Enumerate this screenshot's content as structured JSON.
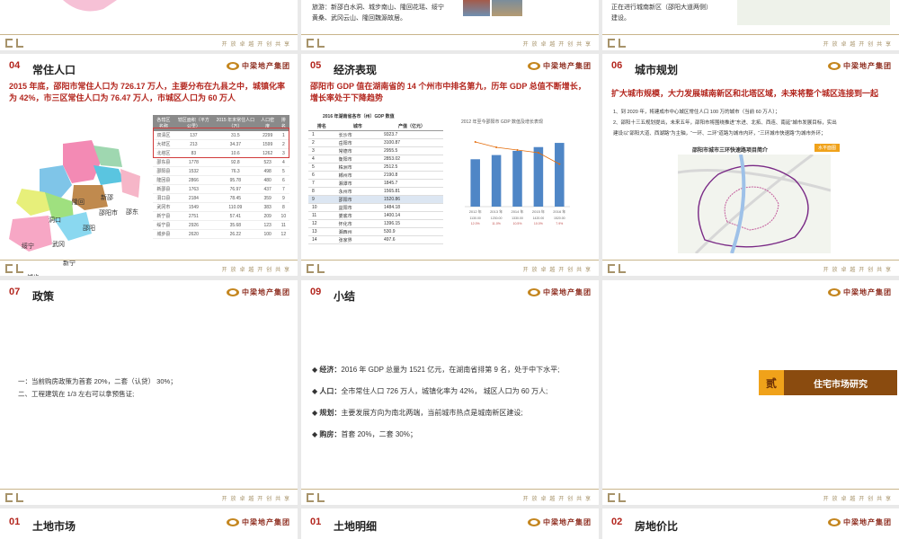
{
  "footer_tagline": "开 放   卓 越   开 创   共 享",
  "brand": "中梁地产集团",
  "top_row": {
    "s2_text_line1": "旅游：新邵白水洞、城步南山、隆回花瑶、绥宁",
    "s2_text_line2": "黄桑、武冈云山、隆回魏源故居。",
    "s3_text_line1": "正在进行城南新区（邵阳大道两侧）",
    "s3_text_line2": "建设。"
  },
  "slides": {
    "population": {
      "num": "04",
      "title": "常住人口",
      "headline": "2015 年底，邵阳市常住人口为 726.17 万人，主要分布在九县之中，城镇化率为 42%，市三区常住人口为 76.47 万人，市城区人口为 60 万人",
      "map_labels": [
        "隆回",
        "新邵",
        "邵阳市",
        "邵东",
        "洞口",
        "邵阳",
        "绥宁",
        "武冈",
        "新宁",
        "城步"
      ],
      "table_headers": [
        "各辖区名称",
        "辖区面积（平方公里）",
        "2015 年末常住人口（万）",
        "人口密度",
        "排名"
      ],
      "table_rows": [
        [
          "双清区",
          "137",
          "31.5",
          "2299",
          "1"
        ],
        [
          "大祥区",
          "213",
          "34.37",
          "1599",
          "2"
        ],
        [
          "北塔区",
          "83",
          "10.6",
          "1262",
          "3"
        ],
        [
          "邵东县",
          "1778",
          "92.8",
          "523",
          "4"
        ],
        [
          "邵阳县",
          "1532",
          "76.3",
          "498",
          "5"
        ],
        [
          "隆回县",
          "2866",
          "95.78",
          "480",
          "6"
        ],
        [
          "新邵县",
          "1763",
          "76.97",
          "437",
          "7"
        ],
        [
          "洞口县",
          "2184",
          "78.45",
          "359",
          "9"
        ],
        [
          "武冈市",
          "1549",
          "110.09",
          "383",
          "8"
        ],
        [
          "新宁县",
          "2751",
          "57.41",
          "209",
          "10"
        ],
        [
          "绥宁县",
          "2926",
          "35.68",
          "123",
          "11"
        ],
        [
          "城步县",
          "2620",
          "26.22",
          "100",
          "12"
        ]
      ]
    },
    "economy": {
      "num": "05",
      "title": "经济表现",
      "headline": "邵阳市 GDP 值在湖南省的 14 个州市中排名第九，历年 GDP 总值不断增长，增长率处于下降趋势",
      "table_title": "2016 年湖南省各市（州）GDP 数值",
      "table_headers": [
        "排名",
        "城市",
        "产值（亿元）"
      ],
      "table_rows": [
        [
          "1",
          "长沙市",
          "9323.7"
        ],
        [
          "2",
          "岳阳市",
          "3100.87"
        ],
        [
          "3",
          "常德市",
          "2955.5"
        ],
        [
          "4",
          "衡阳市",
          "2853.02"
        ],
        [
          "5",
          "株洲市",
          "2512.5"
        ],
        [
          "6",
          "郴州市",
          "2190.8"
        ],
        [
          "7",
          "湘潭市",
          "1845.7"
        ],
        [
          "8",
          "永州市",
          "1565.81"
        ],
        [
          "9",
          "邵阳市",
          "1520.86"
        ],
        [
          "10",
          "益阳市",
          "1484.18"
        ],
        [
          "11",
          "娄底市",
          "1400.14"
        ],
        [
          "12",
          "怀化市",
          "1396.15"
        ],
        [
          "13",
          "湘西州",
          "530.9"
        ],
        [
          "14",
          "张家界",
          "497.6"
        ]
      ]
    },
    "planning": {
      "num": "06",
      "title": "城市规划",
      "headline": "扩大城市规模，大力发展城南新区和北塔区域，未来将整个城区连接到一起",
      "text_line1": "1、到 2020 年，将建成市中心城区常住人口 100 万的城市（当前 60 万人）；",
      "text_line2": "2、邵阳十三五规划提出，未来五年，邵阳市将围绕推进“东进、北拓、西连、南延”城市发展目标，实出",
      "text_line3": "建设以“邵阳大道、西湖路”为主轴，“一环、二环”道路为城市内环，“三环城市快速路”为城市外环；",
      "map_title": "邵阳市城市三环快速路项目简介",
      "map_badge": "水平面图"
    },
    "policy": {
      "num": "07",
      "title": "政策",
      "line1": "一：当前购房政策为首套 20%，二套（认贷） 30%；",
      "line2": "二、工程建筑在 1/3 左右可以拿预售证;"
    },
    "summary": {
      "num": "09",
      "title": "小结",
      "items": [
        {
          "key": "经济：",
          "text": "2016 年 GDP 总量为 1521 亿元，在湖南省排第 9 名，处于中下水平;"
        },
        {
          "key": "人口：",
          "text": "全市常住人口 726 万人，城镇化率为 42%， 城区人口为 60 万人;"
        },
        {
          "key": "规划：",
          "text": "主要发展方向为南北两端，当前城市热点是城南新区建设;"
        },
        {
          "key": "购房：",
          "text": "首套 20%，二套 30%；"
        }
      ]
    },
    "section": {
      "char": "贰",
      "label": "住宅市场研究"
    },
    "land_market": {
      "num": "01",
      "title": "土地市场"
    },
    "land_detail": {
      "num": "01",
      "title": "土地明细"
    },
    "land_price": {
      "num": "02",
      "title": "房地价比"
    }
  },
  "chart_data": {
    "type": "bar",
    "title": "2012 年至今邵阳市 GDP 数值及增长表现",
    "categories": [
      "2012 年",
      "2013 年",
      "2014 年",
      "2015 年",
      "2016 年"
    ],
    "series": [
      {
        "name": "GDP",
        "values": [
          1130,
          1230,
          1330,
          1420,
          1520
        ],
        "color": "#4f86c6"
      }
    ],
    "growth_values": [
      12.0,
      11.0,
      10.5,
      10.0,
      7.9
    ],
    "bar_labels": [
      "1130.00",
      "1230.00",
      "1330.00",
      "1420.00",
      "1520.00"
    ],
    "growth_labels": [
      "12.0%",
      "11.0%",
      "10.5%",
      "10.0%",
      "7.9%"
    ],
    "ylim": [
      0,
      1800
    ]
  },
  "colors": {
    "accent": "#b3261e",
    "gold": "#a7936a",
    "brand_orange": "#c4861f",
    "section_brown": "#8a4b0f"
  }
}
